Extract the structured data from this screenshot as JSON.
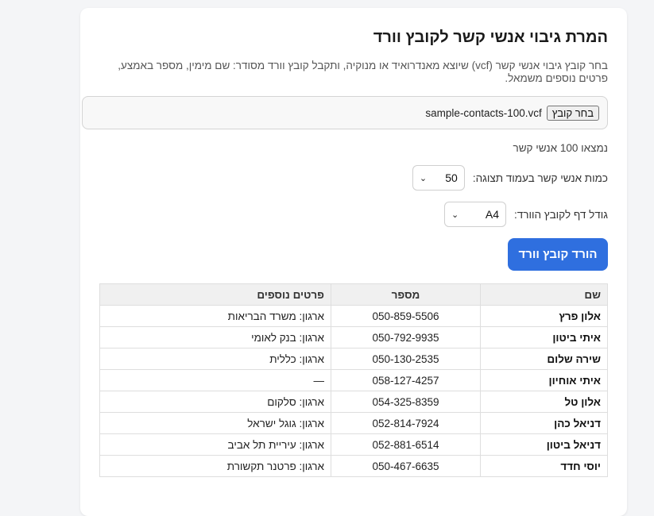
{
  "page": {
    "title": "המרת גיבוי אנשי קשר לקובץ וורד",
    "description": "בחר קובץ גיבוי אנשי קשר (vcf) שיוצא מאנדרואיד או מנוקיה, ותקבל קובץ וורד מסודר: שם מימין, מספר באמצע, פרטים נוספים משמאל."
  },
  "file_input": {
    "button_label": "בחר קובץ",
    "file_name": "sample-contacts-100.vcf"
  },
  "status": {
    "found_text": "נמצאו 100 אנשי קשר"
  },
  "controls": {
    "per_page_label": "כמות אנשי קשר בעמוד תצוגה:",
    "per_page_value": "50",
    "page_size_label": "גודל דף לקובץ הוורד:",
    "page_size_value": "A4"
  },
  "download_button": "הורד קובץ וורד",
  "table": {
    "headers": [
      "שם",
      "מספר",
      "פרטים נוספים"
    ],
    "rows": [
      [
        "אלון פרץ",
        "050-859-5506",
        "ארגון: משרד הבריאות"
      ],
      [
        "איתי ביטון",
        "050-792-9935",
        "ארגון: בנק לאומי"
      ],
      [
        "שירה שלום",
        "050-130-2535",
        "ארגון: כללית"
      ],
      [
        "איתי אוחיון",
        "058-127-4257",
        "—"
      ],
      [
        "אלון טל",
        "054-325-8359",
        "ארגון: סלקום"
      ],
      [
        "דניאל כהן",
        "052-814-7924",
        "ארגון: גוגל ישראל"
      ],
      [
        "דניאל ביטון",
        "052-881-6514",
        "ארגון: עיריית תל אביב"
      ],
      [
        "יוסי חדד",
        "050-467-6635",
        "ארגון: פרטנר תקשורת"
      ]
    ]
  },
  "colors": {
    "primary": "#2f6fdf",
    "background": "#f4f5f7",
    "card": "#ffffff"
  }
}
